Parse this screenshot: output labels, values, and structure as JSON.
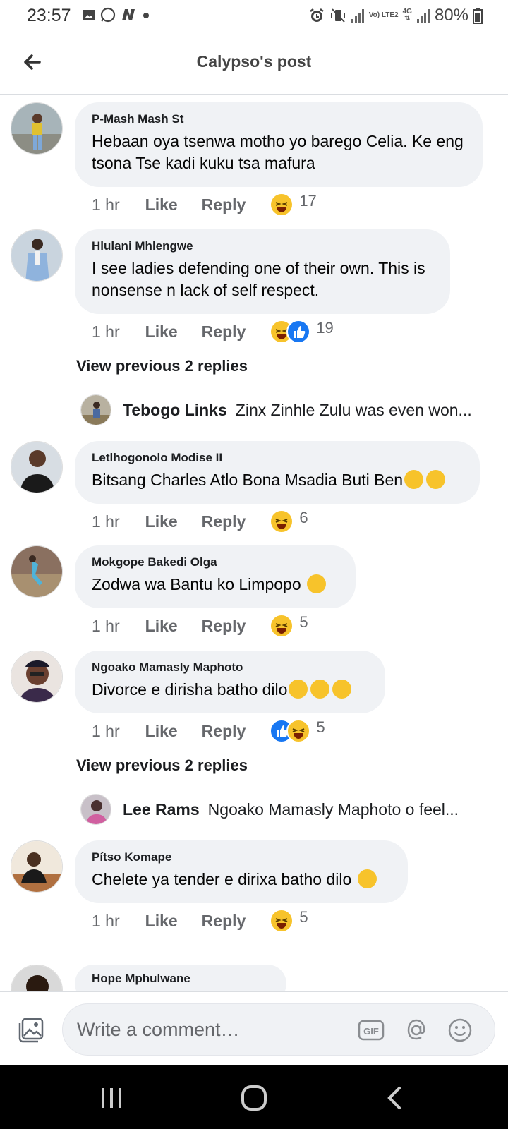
{
  "status_bar": {
    "time": "23:57",
    "battery": "80%",
    "network": "Vo) LTE2",
    "network_type": "4G"
  },
  "header": {
    "title": "Calypso's post"
  },
  "comments": [
    {
      "author": "P-Mash Mash St",
      "text": "Hebaan oya tsenwa motho yo barego Celia. Ke eng tsona Tse kadi kuku tsa mafura",
      "time": "1 hr",
      "like": "Like",
      "reply": "Reply",
      "reactions": [
        "laugh"
      ],
      "count": "17"
    },
    {
      "author": "Hlulani Mhlengwe",
      "text": "I see ladies defending one of their own. This is nonsense n lack of self respect.",
      "time": "1 hr",
      "like": "Like",
      "reply": "Reply",
      "reactions": [
        "laugh",
        "like"
      ],
      "count": "19"
    },
    {
      "author": "Letlhogonolo Modise II",
      "text": "Bitsang Charles Atlo Bona Msadia Buti Ben",
      "time": "1 hr",
      "like": "Like",
      "reply": "Reply",
      "reactions": [
        "laugh"
      ],
      "count": "6"
    },
    {
      "author": "Mokgope Bakedi Olga",
      "text": "Zodwa wa Bantu ko Limpopo",
      "time": "1 hr",
      "like": "Like",
      "reply": "Reply",
      "reactions": [
        "laugh"
      ],
      "count": "5"
    },
    {
      "author": "Ngoako Mamasly Maphoto",
      "text": "Divorce e dirisha batho dilo",
      "time": "1 hr",
      "like": "Like",
      "reply": "Reply",
      "reactions": [
        "like",
        "laugh"
      ],
      "count": "5"
    },
    {
      "author": "Pítso Komape",
      "text": "Chelete ya tender e dirixa batho dilo",
      "time": "1 hr",
      "like": "Like",
      "reply": "Reply",
      "reactions": [
        "laugh"
      ],
      "count": "5"
    },
    {
      "author": "Hope Mphulwane"
    }
  ],
  "reply_threads": [
    {
      "view_previous": "View previous 2 replies",
      "author": "Tebogo Links",
      "text": "Zinx Zinhle Zulu was even won..."
    },
    {
      "view_previous": "View previous 2 replies",
      "author": "Lee Rams",
      "text": "Ngoako Mamasly Maphoto o feel..."
    }
  ],
  "composer": {
    "placeholder": "Write a comment…",
    "gif_label": "GIF"
  },
  "colors": {
    "bubble": "#f0f2f5",
    "like_blue": "#1877f2",
    "haha_yellow": "#f7c32b",
    "secondary_text": "#65676b"
  },
  "icons": [
    "back-arrow-icon",
    "photo-icon",
    "gif-icon",
    "mention-icon",
    "emoji-icon",
    "recents-icon",
    "home-icon",
    "back-icon"
  ]
}
